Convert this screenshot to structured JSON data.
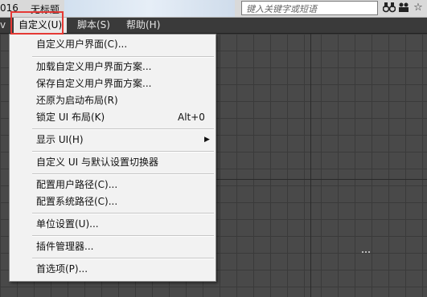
{
  "titlebar": {
    "version": "016",
    "doc_title": "无标题",
    "search_placeholder": "键入关键字或短语"
  },
  "menubar": {
    "stub": "v",
    "items": [
      {
        "label": "自定义(U)",
        "active": true
      },
      {
        "label": "脚本(S)",
        "active": false
      },
      {
        "label": "帮助(H)",
        "active": false
      }
    ]
  },
  "dropdown": {
    "items": [
      {
        "label": "自定义用户界面(C)..."
      },
      {
        "label": "加载自定义用户界面方案..."
      },
      {
        "label": "保存自定义用户界面方案..."
      },
      {
        "label": "还原为启动布局(R)"
      },
      {
        "label": "锁定 UI 布局(K)",
        "shortcut": "Alt+0"
      },
      {
        "label": "显示 UI(H)",
        "submenu_arrow": "▶"
      },
      {
        "label": "自定义 UI 与默认设置切换器"
      },
      {
        "label": "配置用户路径(C)..."
      },
      {
        "label": "配置系统路径(C)..."
      },
      {
        "label": "单位设置(U)..."
      },
      {
        "label": "插件管理器..."
      },
      {
        "label": "首选项(P)..."
      }
    ]
  }
}
